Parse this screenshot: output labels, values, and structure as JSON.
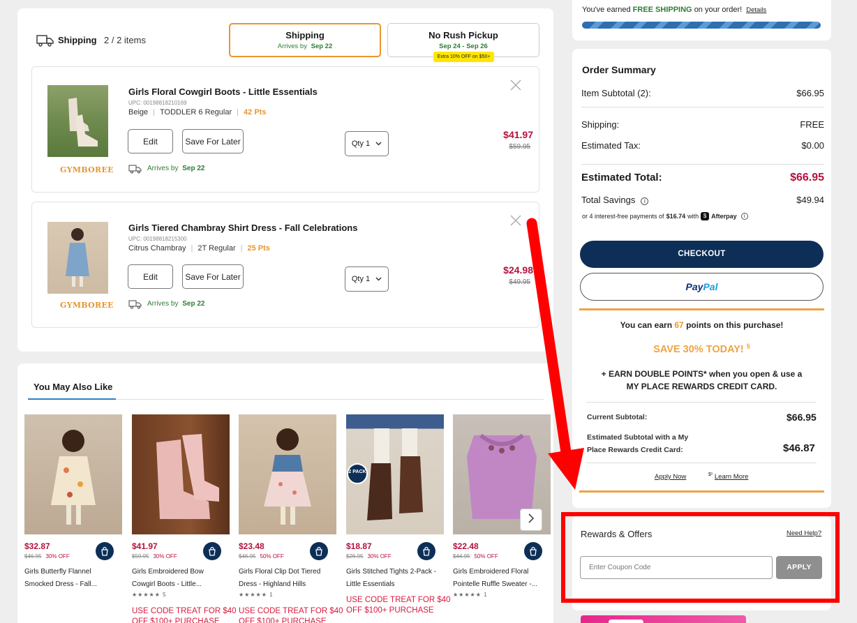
{
  "shipping": {
    "label": "Shipping",
    "count": "2 / 2 items",
    "options": [
      {
        "title": "Shipping",
        "sub_prefix": "Arrives by",
        "sub_date": "Sep 22"
      },
      {
        "title": "No Rush Pickup",
        "sub_date": "Sep 24 - Sep 26",
        "badge": "Extra 10% OFF on $50+"
      }
    ]
  },
  "cart": {
    "items": [
      {
        "name": "Girls Floral Cowgirl Boots - Little Essentials",
        "upc": "UPC: 00198818210169",
        "color": "Beige",
        "size": "TODDLER 6 Regular",
        "pts": "42 Pts",
        "brand": "GYMBOREE",
        "edit": "Edit",
        "save_later": "Save For Later",
        "qty": "Qty 1",
        "price": "$41.97",
        "was": "$59.95",
        "arrives_prefix": "Arrives by",
        "arrives_date": "Sep 22"
      },
      {
        "name": "Girls Tiered Chambray Shirt Dress - Fall Celebrations",
        "upc": "UPC: 00198818215300",
        "color": "Citrus Chambray",
        "size": "2T Regular",
        "pts": "25 Pts",
        "brand": "GYMBOREE",
        "edit": "Edit",
        "save_later": "Save For Later",
        "qty": "Qty 1",
        "price": "$24.98",
        "was": "$49.95",
        "arrives_prefix": "Arrives by",
        "arrives_date": "Sep 22"
      }
    ]
  },
  "recommendations": {
    "title": "You May Also Like",
    "items": [
      {
        "price": "$32.87",
        "was": "$46.95",
        "off": "30% OFF",
        "name1": "Girls Butterfly Flannel",
        "name2": "Smocked Dress - Fall...",
        "stars": "",
        "promo1": "",
        "promo2": ""
      },
      {
        "price": "$41.97",
        "was": "$59.95",
        "off": "30% OFF",
        "name1": "Girls Embroidered Bow",
        "name2": "Cowgirl Boots - Little...",
        "stars": "★★★★★ 5",
        "promo1": "USE CODE TREAT FOR $40",
        "promo2": "OFF $100+ PURCHASE"
      },
      {
        "price": "$23.48",
        "was": "$46.95",
        "off": "50% OFF",
        "name1": "Girls Floral Clip Dot Tiered",
        "name2": "Dress - Highland Hills",
        "stars": "★★★★★ 1",
        "promo1": "USE CODE TREAT FOR $40",
        "promo2": "OFF $100+ PURCHASE"
      },
      {
        "price": "$18.87",
        "was": "$26.95",
        "off": "30% OFF",
        "name1": "Girls Stitched Tights 2-Pack -",
        "name2": "Little Essentials",
        "stars": "",
        "promo1": "USE CODE TREAT FOR $40",
        "promo2": "OFF $100+ PURCHASE",
        "badge": "2 PACK"
      },
      {
        "price": "$22.48",
        "was": "$44.95",
        "off": "50% OFF",
        "name1": "Girls Embroidered Floral",
        "name2": "Pointelle Ruffle Sweater -...",
        "stars": "★★★★★ 1",
        "promo1": "",
        "promo2": ""
      }
    ]
  },
  "free_shipping": {
    "prefix": "You've earned",
    "highlight": "FREE SHIPPING",
    "suffix": "on your order!",
    "link": "Details"
  },
  "summary": {
    "title": "Order Summary",
    "subtotal_label": "Item Subtotal (2):",
    "subtotal": "$66.95",
    "shipping_label": "Shipping:",
    "shipping": "FREE",
    "tax_label": "Estimated Tax:",
    "tax": "$0.00",
    "total_label": "Estimated Total:",
    "total": "$66.95",
    "savings_label": "Total Savings",
    "savings": "$49.94",
    "afterpay_prefix": "or 4 interest-free payments of",
    "afterpay_amount": "$16.74",
    "afterpay_with": "with",
    "afterpay_brand": "Afterpay",
    "checkout": "CHECKOUT",
    "paypal_pay": "Pay",
    "paypal_pal": "Pal"
  },
  "rewards_promo": {
    "earn_prefix": "You can earn",
    "earn_points": "67",
    "earn_suffix": "points on this purchase!",
    "save_headline": "SAVE 30% TODAY!",
    "save_mark": "§",
    "double_line1": "+ EARN DOUBLE POINTS* when you open & use a",
    "double_line2": "MY PLACE REWARDS CREDIT CARD.",
    "current_label": "Current Subtotal:",
    "current_value": "$66.95",
    "est_label1": "Estimated Subtotal with a My",
    "est_label2": "Place Rewards Credit Card:",
    "est_value": "$46.87",
    "apply_now": "Apply Now",
    "learn_mark": "$¹",
    "learn_more": "Learn More"
  },
  "offers": {
    "title": "Rewards & Offers",
    "help": "Need Help?",
    "coupon_placeholder": "Enter Coupon Code",
    "apply": "APPLY"
  },
  "colors": {
    "navy": "#0d2f57",
    "sale_red": "#b3123c",
    "orange": "#e8962e",
    "green": "#2e7d32",
    "annotation_red": "#ff0000"
  }
}
